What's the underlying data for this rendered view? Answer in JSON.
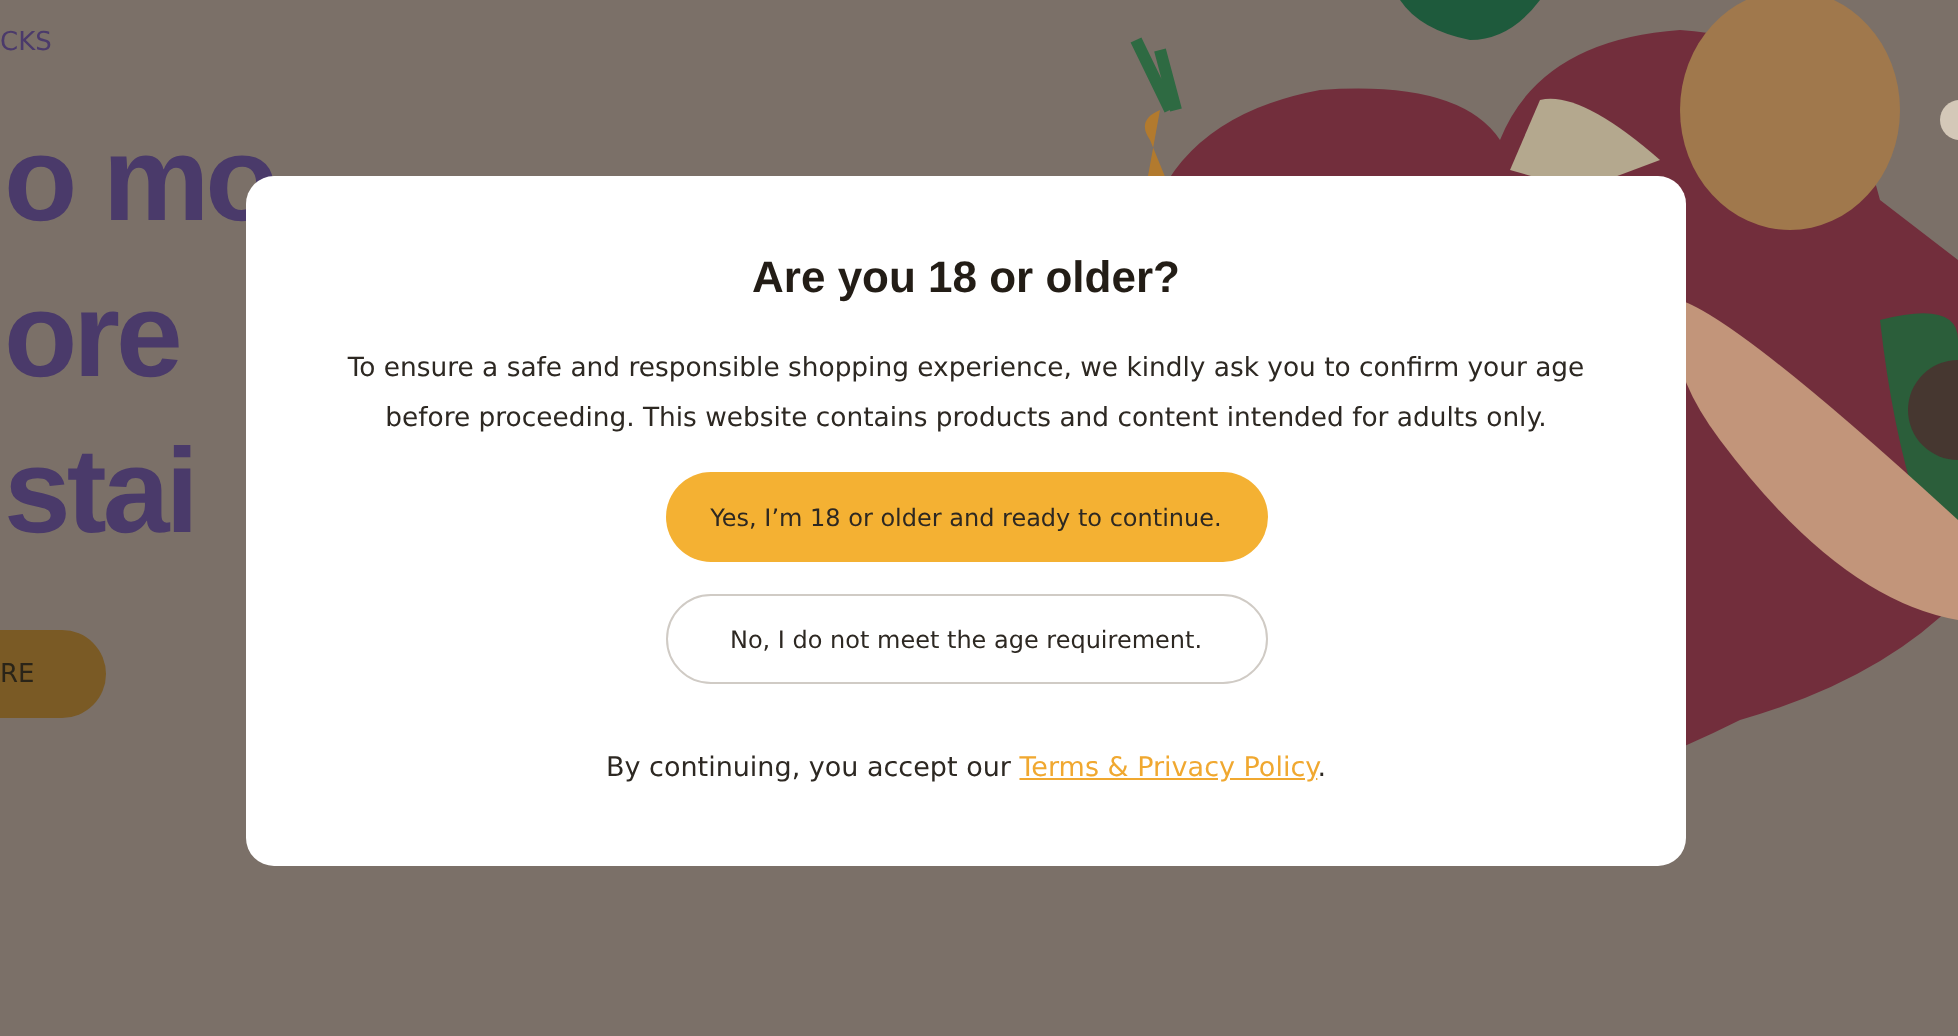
{
  "page": {
    "nav_link": "CKS",
    "headline_lines": [
      "o mo",
      "ore",
      "stai"
    ],
    "hero_button": "RE"
  },
  "dialog": {
    "title": "Are you 18 or older?",
    "message": "To ensure a safe and responsible shopping experience, we kindly ask you to confirm your age before proceeding. This website contains products and content intended for adults only.",
    "buttons": [
      {
        "kind": "primary",
        "label": "Yes, I’m 18 or older and ready to continue."
      },
      {
        "kind": "outline",
        "label": "No, I do not meet the age requirement."
      }
    ],
    "footer_text": "By continuing, you accept our ",
    "footer_link": "Terms & Privacy Policy",
    "footer_end": "."
  }
}
